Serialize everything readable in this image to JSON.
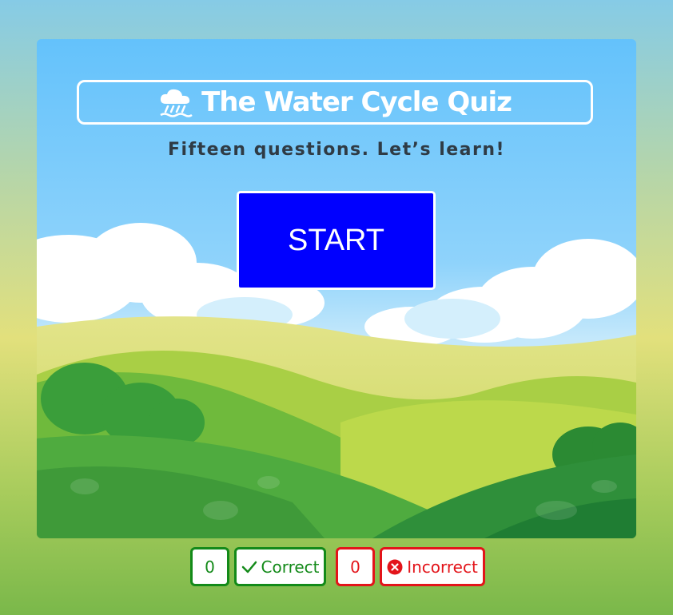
{
  "quiz": {
    "title": "The Water Cycle Quiz",
    "title_icon": "rain-cloud-icon",
    "subtitle": "Fifteen questions. Let’s learn!",
    "start_label": "START"
  },
  "score": {
    "correct_count": "0",
    "correct_label": "Correct",
    "correct_icon": "check-icon",
    "incorrect_count": "0",
    "incorrect_label": "Incorrect",
    "incorrect_icon": "close-circle-icon"
  },
  "colors": {
    "start_button": "#0000ff",
    "correct": "#138a19",
    "incorrect": "#e3141a",
    "sky": "#6ec6fb"
  }
}
